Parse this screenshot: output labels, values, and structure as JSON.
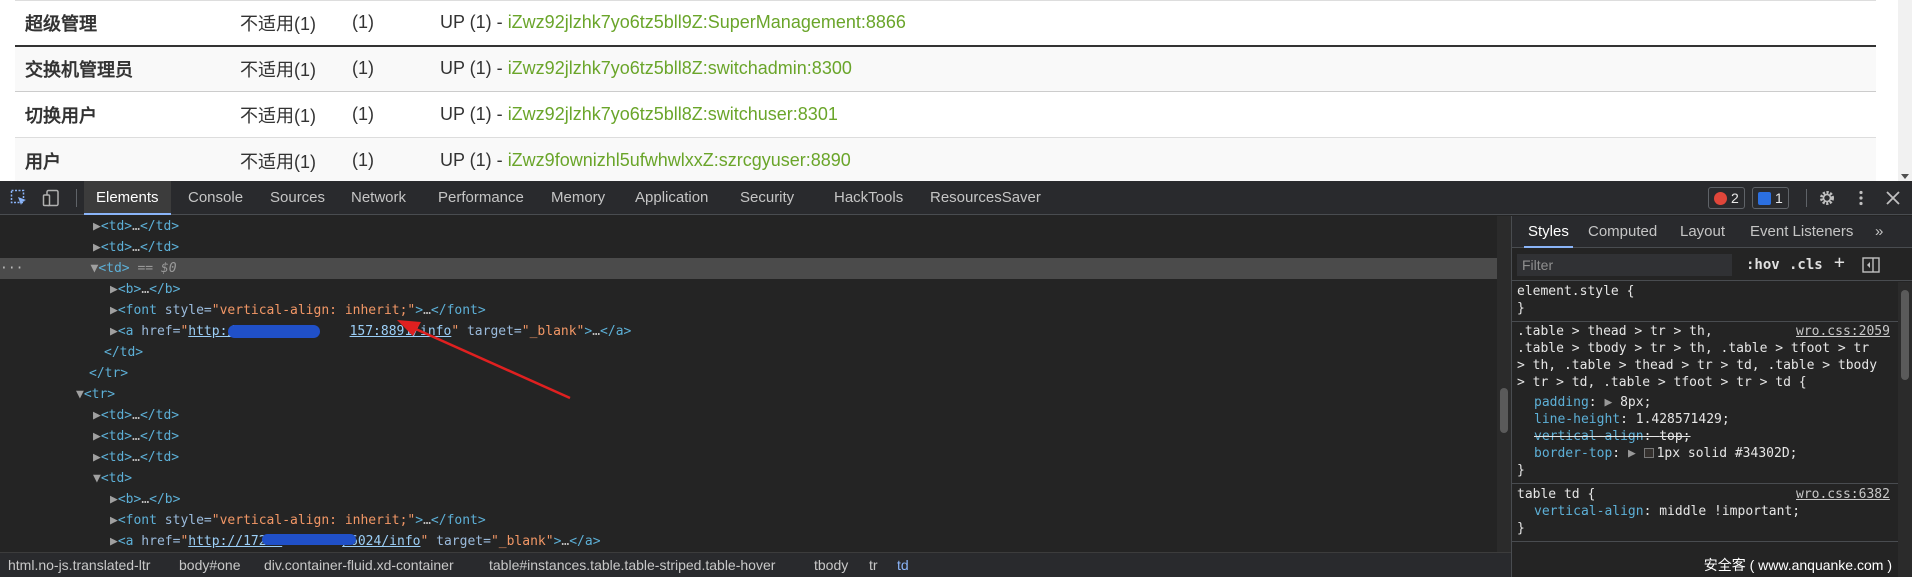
{
  "table": {
    "rows": [
      {
        "name": "超级管理",
        "status": "不适用(1)",
        "count": "(1)",
        "up": "UP (1) - ",
        "link": "iZwz92jlzhk7yo6tz5bll9Z:SuperManagement:8866"
      },
      {
        "name": "交换机管理员",
        "status": "不适用(1)",
        "count": "(1)",
        "up": "UP (1) - ",
        "link": "iZwz92jlzhk7yo6tz5bll8Z:switchadmin:8300"
      },
      {
        "name": "切换用户",
        "status": "不适用(1)",
        "count": "(1)",
        "up": "UP (1) - ",
        "link": "iZwz92jlzhk7yo6tz5bll8Z:switchuser:8301"
      },
      {
        "name": "用户",
        "status": "不适用(1)",
        "count": "(1)",
        "up": "UP (1) - ",
        "link": "iZwz9fownizhl5ufwhwlxxZ:szrcgyuser:8890"
      }
    ]
  },
  "devtools": {
    "tabs": [
      "Elements",
      "Console",
      "Sources",
      "Network",
      "Performance",
      "Memory",
      "Application",
      "Security",
      "HackTools",
      "ResourcesSaver"
    ],
    "active_tab": "Elements",
    "errors_count": "2",
    "messages_count": "1",
    "dom": {
      "td": "<td>",
      "td_close": "</td>",
      "ellipsis": "…",
      "selected_suffix": " == $0",
      "dots": "···",
      "b_open": "<b>",
      "b_close": "</b>",
      "font_open": "<font",
      "font_style_attr": " style=",
      "font_style_val": "\"vertical-align: inherit;\"",
      "font_end": ">",
      "font_close": "</font>",
      "a_open": "<a",
      "href_attr": " href=",
      "quote": "\"",
      "href1_a": "http://172",
      "href1_b": "157:8891/info",
      "href2_a": "http://172.1",
      "href2_b": "/6024/info",
      "target_attr": " target=",
      "target_val": "\"_blank\"",
      "a_end": ">",
      "a_close": "</a>",
      "tr_close": "</tr>",
      "tr_open": "<tr>"
    },
    "breadcrumbs": [
      "html.no-js.translated-ltr",
      "body#one",
      "div.container-fluid.xd-container",
      "table#instances.table.table-striped.table-hover",
      "tbody",
      "tr",
      "td"
    ],
    "styles": {
      "subtabs": [
        "Styles",
        "Computed",
        "Layout",
        "Event Listeners",
        "»"
      ],
      "filter_placeholder": "Filter",
      "hov": ":hov",
      "cls": ".cls",
      "element_style": "element.style {",
      "close_brace": "}",
      "rule1_selector_lines": [
        ".table > thead > tr > th,",
        ".table > tbody > tr > th, .table > tfoot > tr",
        "> th, .table > thead > tr > td, .table > tbody",
        "> tr > td, .table > tfoot > tr > td {"
      ],
      "rule1_source": "wro.css:2059",
      "rule1_props": [
        {
          "name": "padding",
          "value": "8px;",
          "struck": false,
          "arrow": true,
          "swatch": false
        },
        {
          "name": "line-height",
          "value": "1.428571429;",
          "struck": false,
          "arrow": false,
          "swatch": false
        },
        {
          "name": "vertical-align",
          "value": "top;",
          "struck": true,
          "arrow": false,
          "swatch": false
        },
        {
          "name": "border-top",
          "value": "1px solid #34302D;",
          "struck": false,
          "arrow": true,
          "swatch": true
        }
      ],
      "rule2_selector": "table td {",
      "rule2_source": "wro.css:6382",
      "rule2_props": [
        {
          "name": "vertical-align",
          "value": "middle !important;"
        }
      ]
    },
    "watermark": "安全客 ( www.anquanke.com )"
  },
  "colors": {
    "link_green": "#6aa52a",
    "devtools_bg": "#242424",
    "tag_blue": "#5db0d7",
    "attr_value_orange": "#f29766",
    "error_red": "#e0463a",
    "message_blue": "#2b6fe0",
    "annotation_arrow": "#e02020",
    "redaction_blue": "#2050c8"
  }
}
